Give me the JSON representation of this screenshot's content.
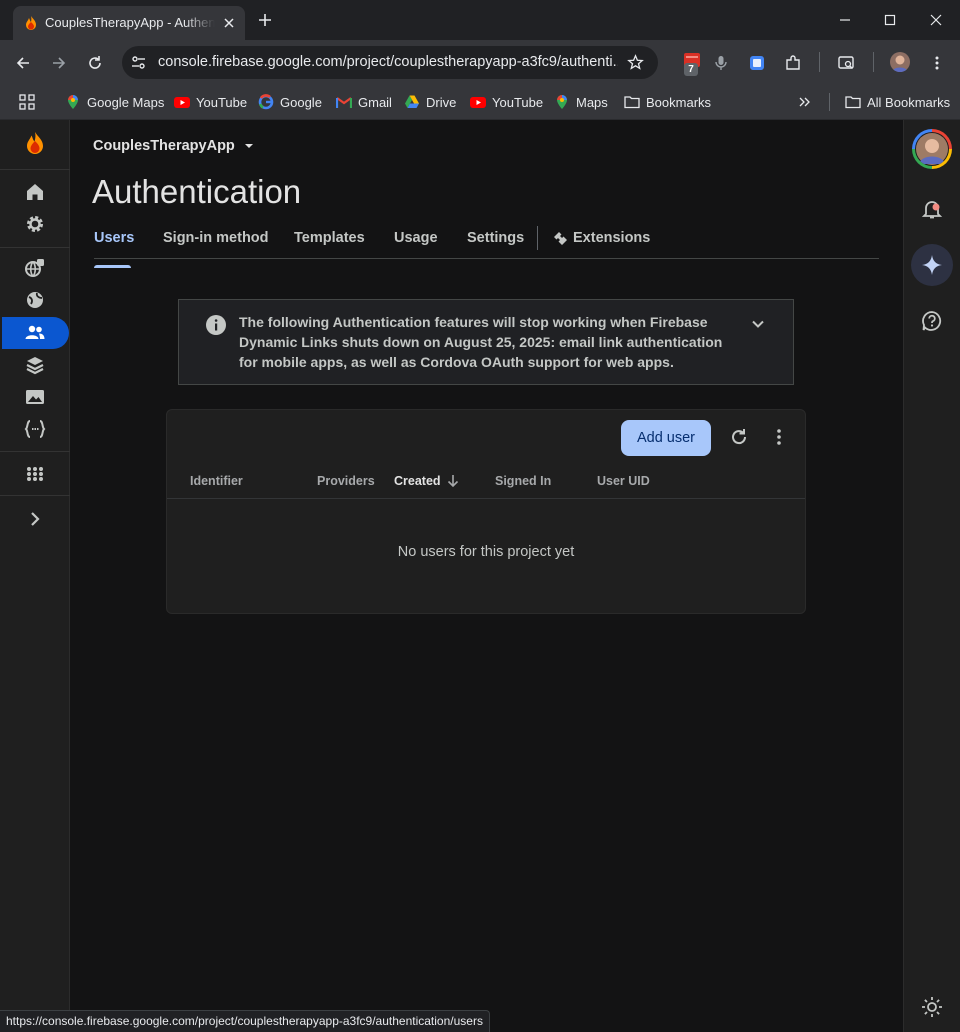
{
  "browser": {
    "tab_title": "CouplesTherapyApp - Authentication",
    "url": "console.firebase.google.com/project/couplestherapyapp-a3fc9/authenti...",
    "extension_badge": "7",
    "bookmarks": [
      "Google Maps",
      "YouTube",
      "Google",
      "Gmail",
      "Drive",
      "YouTube",
      "Maps",
      "Bookmarks"
    ],
    "all_bookmarks": "All Bookmarks",
    "status_url": "https://console.firebase.google.com/project/couplestherapyapp-a3fc9/authentication/users"
  },
  "console": {
    "project_name": "CouplesTherapyApp",
    "page_title": "Authentication",
    "tabs": [
      "Users",
      "Sign-in method",
      "Templates",
      "Usage",
      "Settings",
      "Extensions"
    ],
    "active_tab": "Users",
    "notice": "The following Authentication features will stop working when Firebase Dynamic Links shuts down on August 25, 2025: email link authentication for mobile apps, as well as Cordova OAuth support for web apps.",
    "add_user_label": "Add user",
    "columns": [
      "Identifier",
      "Providers",
      "Created",
      "Signed In",
      "User UID"
    ],
    "sorted_column": "Created",
    "empty_message": "No users for this project yet"
  },
  "colors": {
    "accent": "#a8c7fa",
    "active_rail": "#0b57d0",
    "background": "#131314"
  },
  "icons": {
    "rail": [
      "firebase-logo",
      "home-icon",
      "settings-icon",
      "app-check-icon",
      "hosting-icon",
      "authentication-icon",
      "firestore-icon",
      "storage-icon",
      "functions-icon",
      "apps-grid-icon",
      "expand-icon"
    ],
    "right_rail": [
      "avatar",
      "notifications-icon",
      "gemini-sparkle-icon",
      "help-icon",
      "theme-icon"
    ]
  }
}
